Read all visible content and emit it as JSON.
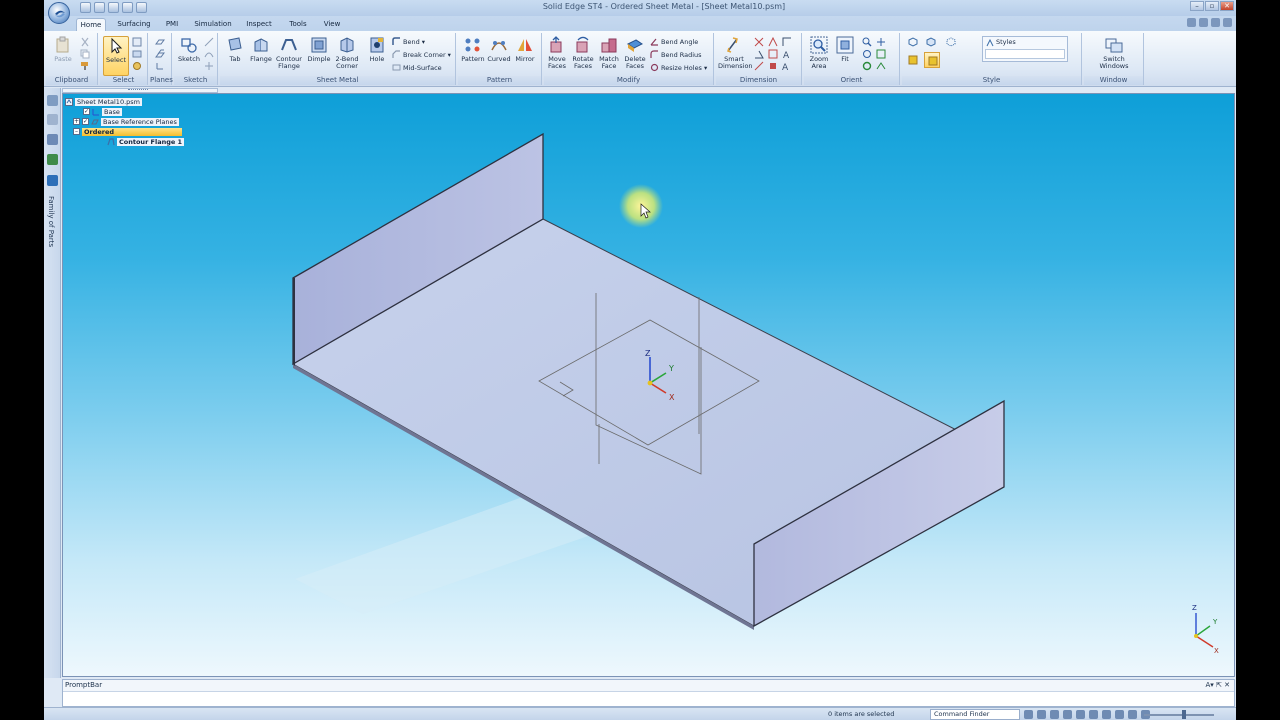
{
  "window": {
    "title": "Solid Edge ST4 - Ordered Sheet Metal - [Sheet Metal10.psm]",
    "controls": [
      "–",
      "▫",
      "✕"
    ]
  },
  "tabs": [
    {
      "label": "Home",
      "active": true
    },
    {
      "label": "Surfacing"
    },
    {
      "label": "PMI"
    },
    {
      "label": "Simulation"
    },
    {
      "label": "Inspect"
    },
    {
      "label": "Tools"
    },
    {
      "label": "View"
    }
  ],
  "ribbon": {
    "clipboard": {
      "label": "Clipboard",
      "paste": "Paste"
    },
    "select": {
      "label": "Select",
      "select": "Select"
    },
    "planes": {
      "label": "Planes"
    },
    "sketch": {
      "label": "Sketch",
      "sketch": "Sketch"
    },
    "sheet_metal": {
      "label": "Sheet Metal",
      "tab": "Tab",
      "flange": "Flange",
      "contour_flange": [
        "Contour",
        "Flange"
      ],
      "dimple": "Dimple",
      "two_bend_corner": [
        "2-Bend",
        "Corner"
      ],
      "hole": "Hole",
      "bend": "Bend",
      "break_corner": "Break Corner",
      "mid_surface": "Mid-Surface"
    },
    "pattern": {
      "label": "Pattern",
      "pattern": "Pattern",
      "curved": "Curved",
      "mirror": "Mirror"
    },
    "modify": {
      "label": "Modify",
      "move_faces": [
        "Move",
        "Faces"
      ],
      "rotate_faces": [
        "Rotate",
        "Faces"
      ],
      "match_face": [
        "Match",
        "Face"
      ],
      "delete_faces": [
        "Delete",
        "Faces"
      ],
      "bend_angle": "Bend Angle",
      "bend_radius": "Bend Radius",
      "resize_holes": "Resize Holes"
    },
    "dimension": {
      "label": "Dimension",
      "smart_dimension": [
        "Smart",
        "Dimension"
      ]
    },
    "orient": {
      "label": "Orient",
      "zoom_area": [
        "Zoom",
        "Area"
      ],
      "fit": "Fit"
    },
    "style": {
      "label": "Style",
      "styles": "Styles"
    },
    "window": {
      "label": "Window",
      "switch_windows": [
        "Switch",
        "Windows"
      ]
    }
  },
  "left_strip": {
    "family_of_parts": "Family of Parts"
  },
  "tree": {
    "root": "Sheet Metal10.psm",
    "base": "Base",
    "base_reference_planes": "Base Reference Planes",
    "ordered": "Ordered",
    "contour_flange": "Contour Flange 1"
  },
  "triad": {
    "z": "Z",
    "y": "Y",
    "x": "X"
  },
  "prompt_bar": {
    "title": "PromptBar",
    "ctrls": "A▾ ⇱ ✕"
  },
  "status_bar": {
    "items_selected": "0 items are selected",
    "command_finder": "Command Finder"
  },
  "colors": {
    "viewport_top": "#0e9fd8",
    "viewport_bottom": "#eef8fd",
    "part_face": "#bfcae6",
    "selected_highlight": "#ffd363"
  }
}
